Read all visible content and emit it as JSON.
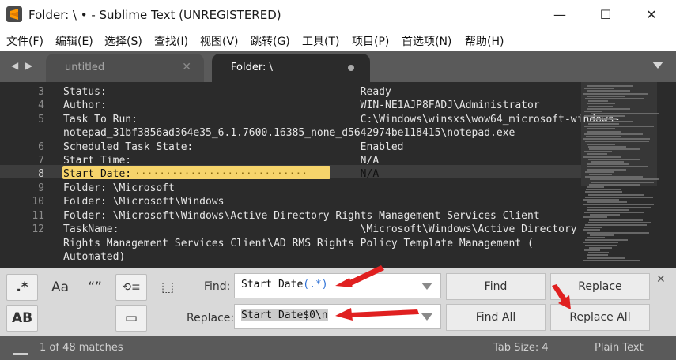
{
  "window": {
    "title": "Folder: \\ • - Sublime Text (UNREGISTERED)",
    "minimize": "—",
    "maximize": "☐",
    "close": "✕"
  },
  "menu": [
    "文件(F)",
    "编辑(E)",
    "选择(S)",
    "查找(I)",
    "视图(V)",
    "跳转(G)",
    "工具(T)",
    "项目(P)",
    "首选项(N)",
    "帮助(H)"
  ],
  "tabs": {
    "inactive_label": "untitled",
    "inactive_close": "✕",
    "active_label": "Folder: \\"
  },
  "editor": {
    "lines": [
      {
        "num": "3",
        "text": "Status:                                         Ready"
      },
      {
        "num": "4",
        "text": "Author:                                         WIN-NE1AJP8FADJ\\Administrator"
      },
      {
        "num": "5",
        "text": "Task To Run:                                    C:\\Windows\\winsxs\\wow64_microsoft-windows-"
      },
      {
        "num": "",
        "text": "notepad_31bf3856ad364e35_6.1.7600.16385_none_d5642974be118415\\notepad.exe"
      },
      {
        "num": "6",
        "text": "Scheduled Task State:                           Enabled"
      },
      {
        "num": "7",
        "text": "Start Time:                                     N/A"
      },
      {
        "num": "8",
        "text": "Start Date:                                     N/A"
      },
      {
        "num": "9",
        "text": "Folder: \\Microsoft"
      },
      {
        "num": "10",
        "text": "Folder: \\Microsoft\\Windows"
      },
      {
        "num": "11",
        "text": "Folder: \\Microsoft\\Windows\\Active Directory Rights Management Services Client"
      },
      {
        "num": "12",
        "text": "TaskName:                                       \\Microsoft\\Windows\\Active Directory"
      },
      {
        "num": "",
        "text": "Rights Management Services Client\\AD RMS Rights Policy Template Management ("
      },
      {
        "num": "",
        "text": "Automated)"
      }
    ],
    "dot_fill": "·································"
  },
  "find_panel": {
    "regex_toggle": ".*",
    "case_toggle": "Aa",
    "word_toggle": "“”",
    "wrap_toggle": "⟲≡",
    "in_selection_toggle": "⬚",
    "highlight_toggle": "AB",
    "preserve_case_toggle": "▭",
    "find_label": "Find:",
    "find_prefix": "Start Date",
    "find_regex": "(.*)",
    "replace_label": "Replace:",
    "replace_value": "Start Date$0\\n",
    "find_button": "Find",
    "find_all_button": "Find All",
    "replace_button": "Replace",
    "replace_all_button": "Replace All",
    "close": "✕"
  },
  "status": {
    "matches": "1 of 48 matches",
    "tab_size": "Tab Size: 4",
    "syntax": "Plain Text"
  }
}
